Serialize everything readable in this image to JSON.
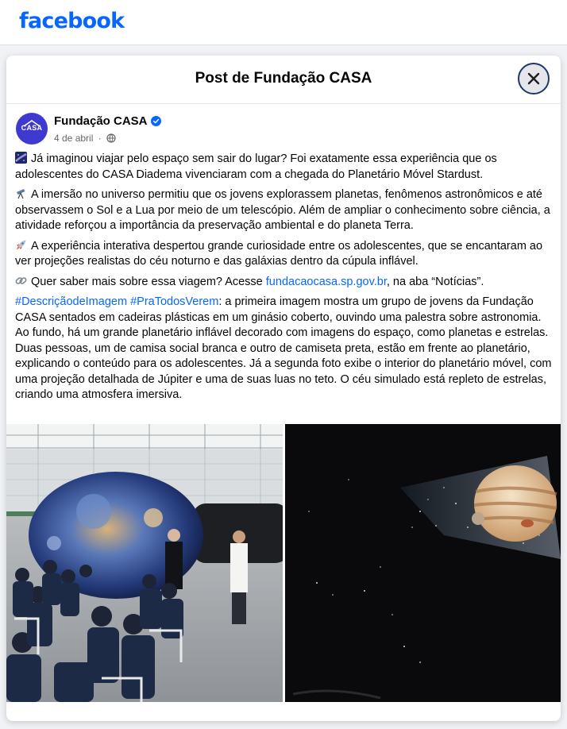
{
  "app": {
    "logo": "facebook"
  },
  "modal": {
    "title": "Post de Fundação CASA",
    "close_icon": "close-icon"
  },
  "author": {
    "avatar_text": "CASA",
    "name": "Fundação CASA",
    "verified_icon": "verified-badge-icon",
    "date": "4 de abril",
    "separator": "·",
    "privacy_icon": "globe-icon"
  },
  "post": {
    "p1": {
      "icon": "milky-way-icon",
      "text": "Já imaginou viajar pelo espaço sem sair do lugar? Foi exatamente essa experiência que os adolescentes do CASA Diadema vivenciaram com a chegada do Planetário Móvel Stardust."
    },
    "p2": {
      "icon": "telescope-icon",
      "text": "A imersão no universo permitiu que os jovens explorassem planetas, fenômenos astronômicos e até observassem o Sol e a Lua por meio de um telescópio. Além de ampliar o conhecimento sobre ciência, a atividade reforçou a importância da preservação ambiental e do planeta Terra."
    },
    "p3": {
      "icon": "rocket-icon",
      "text": "A experiência interativa despertou grande curiosidade entre os adolescentes, que se encantaram ao ver projeções realistas do céu noturno e das galáxias dentro da cúpula inflável."
    },
    "p4": {
      "icon": "link-icon",
      "before": "Quer saber mais sobre essa viagem? Acesse ",
      "link": "fundacaocasa.sp.gov.br",
      "after": ", na aba “Notícias”."
    },
    "p5": {
      "hashtag1": "#DescriçãodeImagem",
      "hashtag2": "#PraTodosVerem",
      "text": ": a primeira imagem mostra um grupo de jovens da Fundação CASA sentados em cadeiras plásticas em um ginásio coberto, ouvindo uma palestra sobre astronomia. Ao fundo, há um grande planetário inflável decorado com imagens do espaço, como planetas e estrelas. Duas pessoas, um de camisa social branca e outro de camiseta preta, estão em frente ao planetário, explicando o conteúdo para os adolescentes. Já a segunda foto exibe o interior do planetário móvel, com uma projeção detalhada de Júpiter e uma de suas luas no teto. O céu simulado está repleto de estrelas, criando uma atmosfera imersiva."
    }
  },
  "photos": [
    {
      "name": "gymnasium-planetarium-photo"
    },
    {
      "name": "jupiter-projection-photo"
    }
  ],
  "colors": {
    "brand": "#0866ff",
    "link": "#0866ff",
    "text": "#050505",
    "secondary_text": "#65676b",
    "background": "#f0f2f5"
  }
}
